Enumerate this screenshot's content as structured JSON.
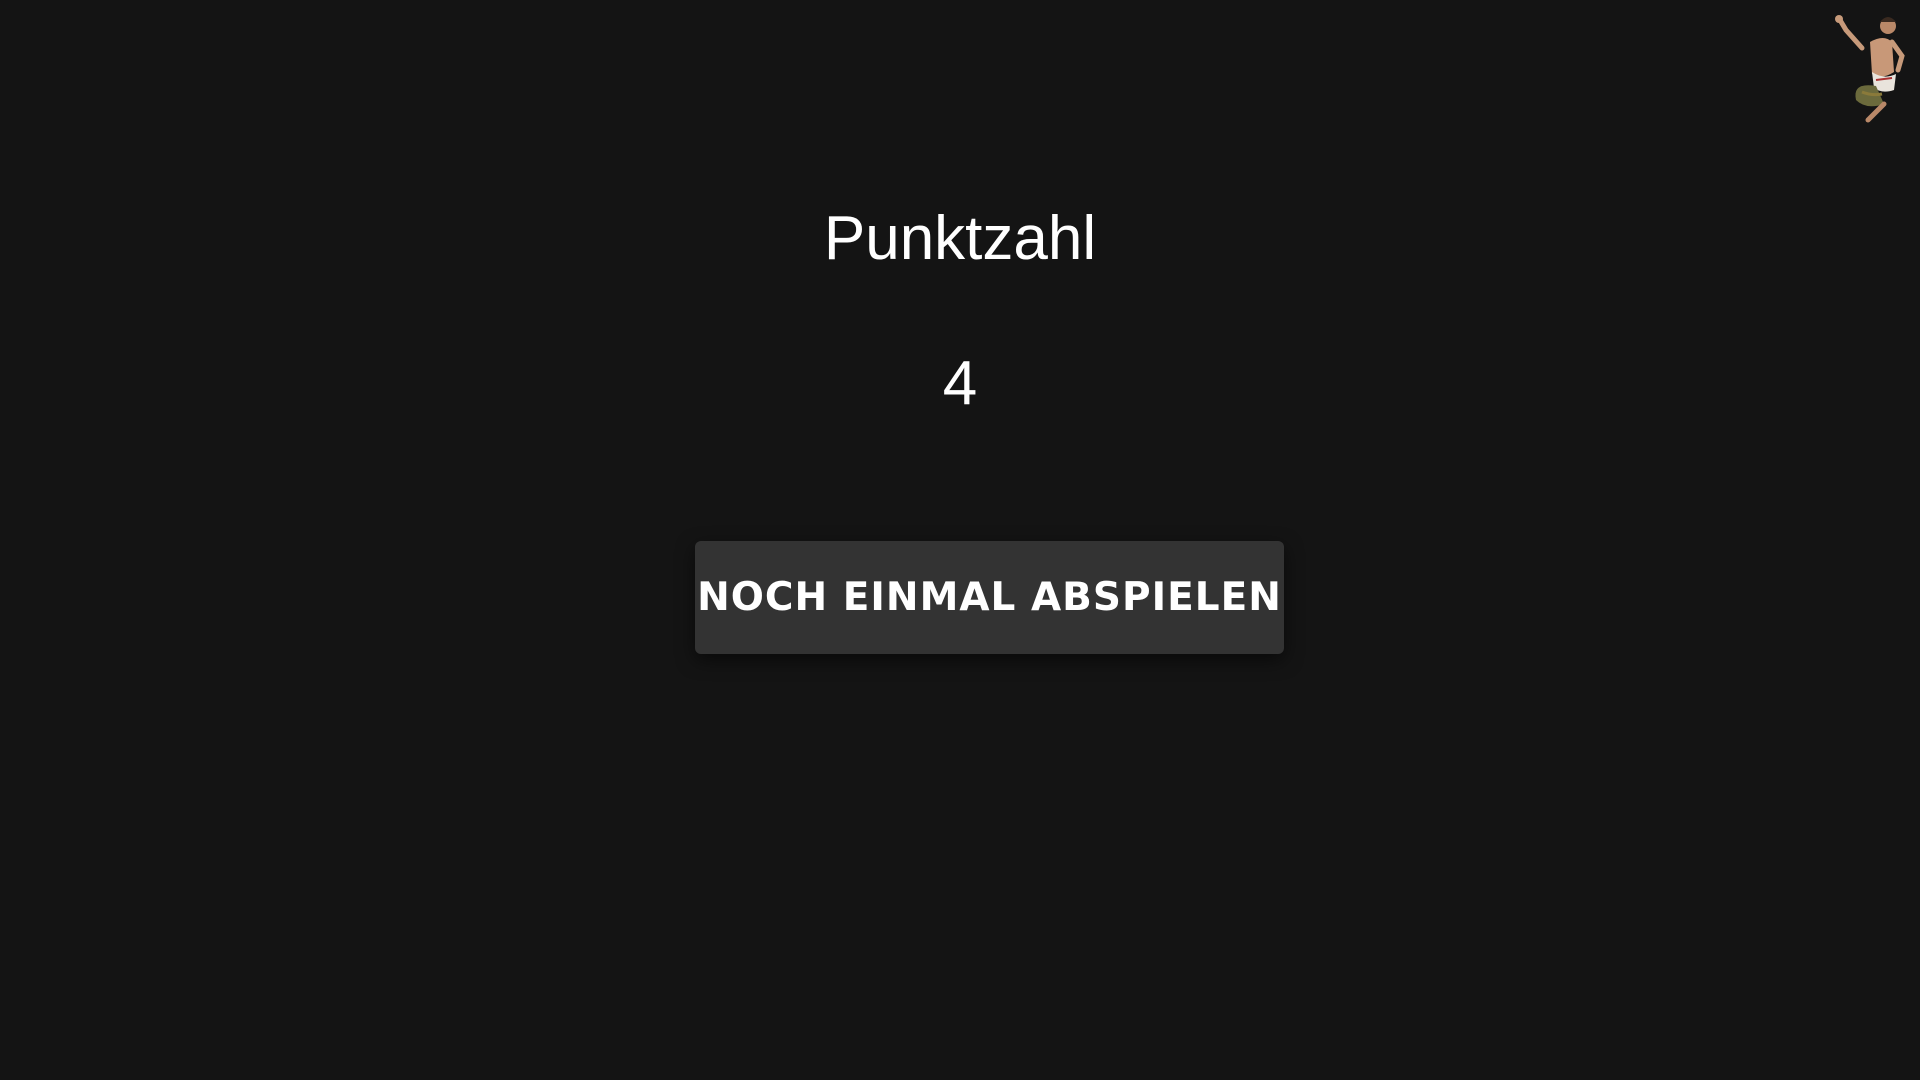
{
  "score": {
    "label": "Punktzahl",
    "value": "4"
  },
  "actions": {
    "play_again_label": "NOCH EINMAL ABSPIELEN"
  },
  "mascot": {
    "icon": "jumping-man-icon"
  },
  "colors": {
    "background": "#141414",
    "button": "#333333",
    "text": "#ffffff"
  }
}
